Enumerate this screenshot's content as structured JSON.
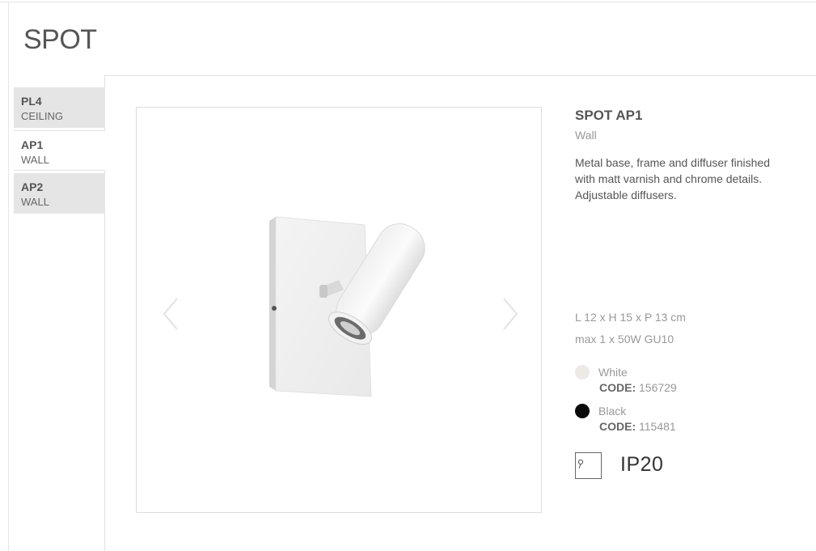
{
  "page": {
    "title": "SPOT"
  },
  "tabs": [
    {
      "code": "PL4",
      "type": "CEILING",
      "active": false
    },
    {
      "code": "AP1",
      "type": "WALL",
      "active": true
    },
    {
      "code": "AP2",
      "type": "WALL",
      "active": false
    }
  ],
  "gallery": {
    "prev_icon": "chevron-left-icon",
    "next_icon": "chevron-right-icon",
    "image_alt": "white wall spot lamp"
  },
  "product": {
    "name": "SPOT AP1",
    "subtitle": "Wall",
    "description": "Metal base, frame and diffuser finished with matt varnish and chrome details. Adjustable diffusers.",
    "dimensions": "L 12 x H 15 x P 13 cm",
    "lamp": "max 1 x 50W GU10"
  },
  "variants": [
    {
      "name": "White",
      "code_label": "CODE:",
      "code": "156729",
      "color": "#ede9e4"
    },
    {
      "name": "Black",
      "code_label": "CODE:",
      "code": "115481",
      "color": "#0a0a0a"
    }
  ],
  "rating": {
    "ip": "IP20",
    "icon": "ip-rating-icon"
  }
}
